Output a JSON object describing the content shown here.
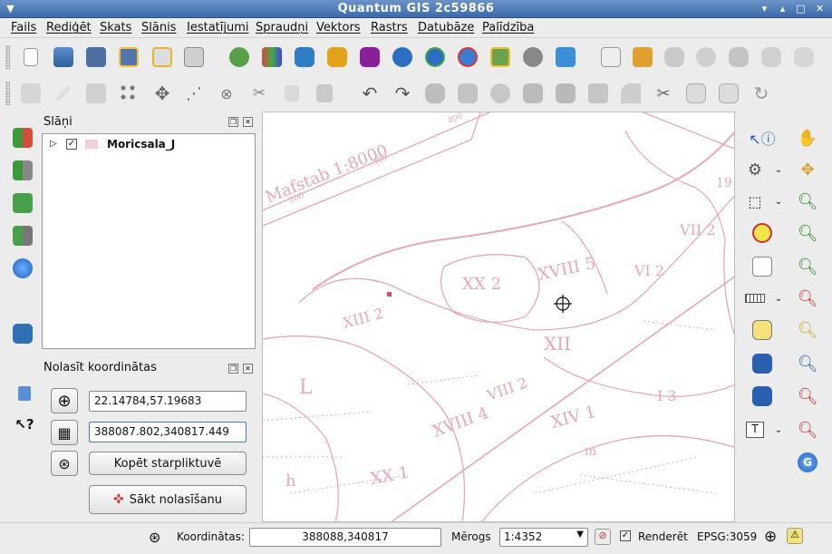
{
  "window": {
    "title": "Quantum GIS 2c59866"
  },
  "menu": [
    "Fails",
    "Rediģēt",
    "Skats",
    "Slānis",
    "Iestatījumi",
    "Spraudņi",
    "Vektors",
    "Rastrs",
    "Datubāze",
    "Palīdzība"
  ],
  "layers_panel": {
    "title": "Slāņi",
    "layers": [
      {
        "name": "Moricsala_J",
        "checked": true
      }
    ]
  },
  "coord_panel": {
    "title": "Nolasīt koordinātas",
    "geo_value": "22.14784,57.19683",
    "proj_value": "388087.802,340817.449",
    "copy_label": "Kopēt starpliktuvē",
    "start_label": "Sākt nolasīšanu"
  },
  "status": {
    "coord_label": "Koordinātas:",
    "coord_value": "388088,340817",
    "scale_label": "Mērogs",
    "scale_value": "1:4352",
    "render_label": "Renderēt",
    "epsg": "EPSG:3059"
  },
  "map_labels": {
    "scale_text": "Mafstab 1:8000",
    "n300": "300",
    "n400": "400",
    "n200": "200",
    "xx": "XX 2",
    "xviii": "XVIII 5",
    "vi": "VI 2",
    "xiii": "XIII 2",
    "xii": "XII",
    "viii": "VIII 2",
    "xviii4": "XVIII 4",
    "xiv": "XIV 1",
    "i3": "I 3",
    "xx1": "XX 1",
    "l": "L",
    "h": "h",
    "m": "m",
    "n19": "19",
    "vii": "VII 2"
  },
  "colors": {
    "map_ink": "#e7a7b5",
    "title_blue": "#3c6aa8"
  }
}
